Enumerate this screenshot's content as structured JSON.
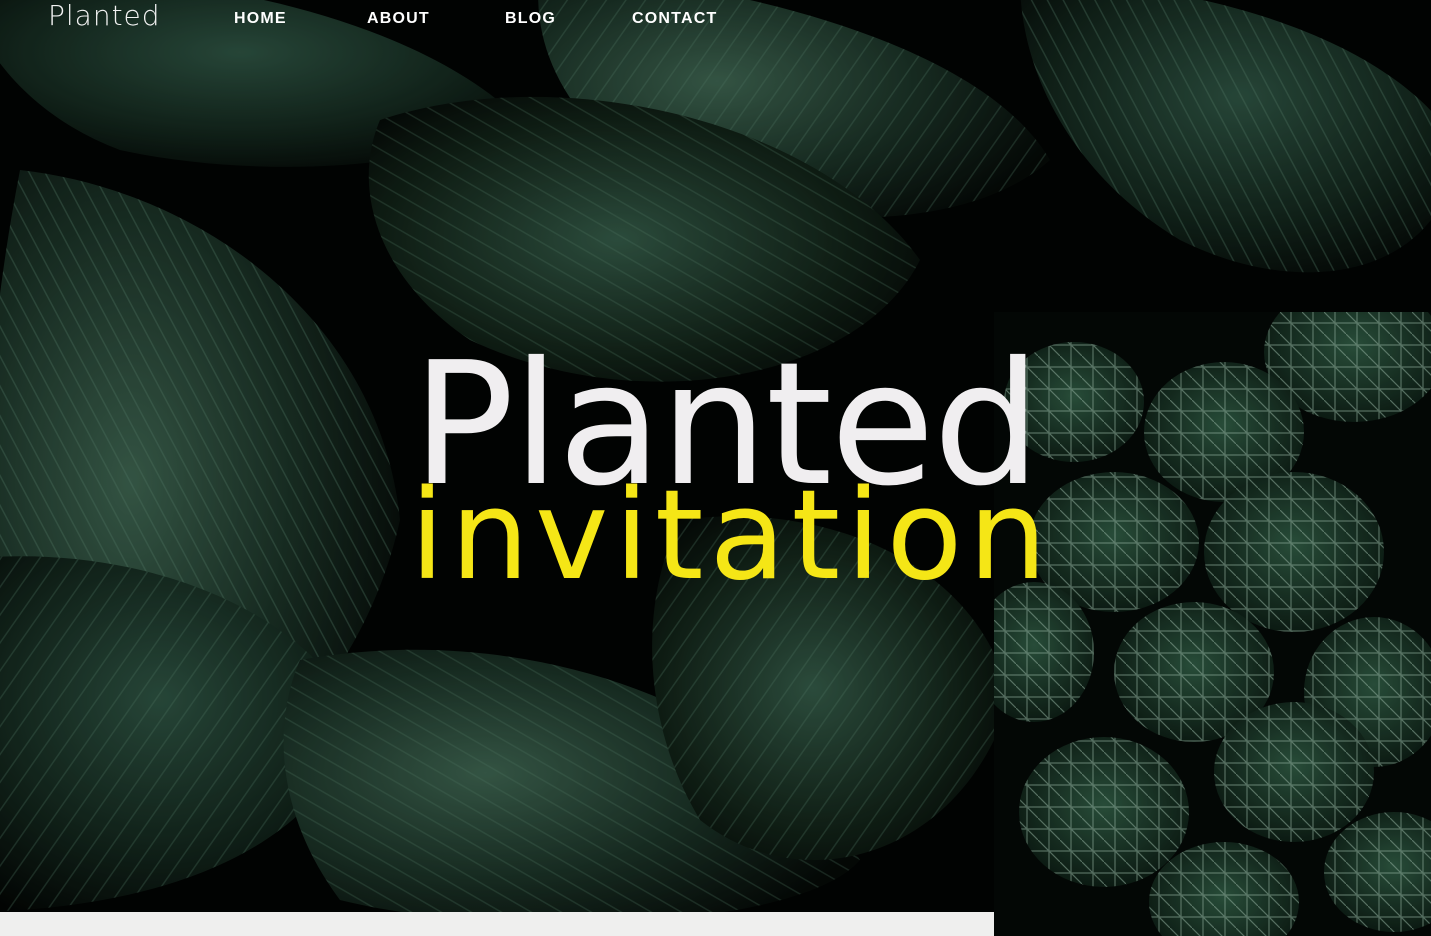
{
  "nav": {
    "logo": "Planted",
    "links": [
      {
        "label": "HOME"
      },
      {
        "label": "ABOUT"
      },
      {
        "label": "BLOG"
      },
      {
        "label": "CONTACT"
      }
    ]
  },
  "hero": {
    "title": "Planted",
    "subtitle": "invitation"
  },
  "colors": {
    "title": "#f0eef0",
    "subtitle": "#f5e616",
    "background": "#020403",
    "leaf": "#2d4b3b"
  }
}
